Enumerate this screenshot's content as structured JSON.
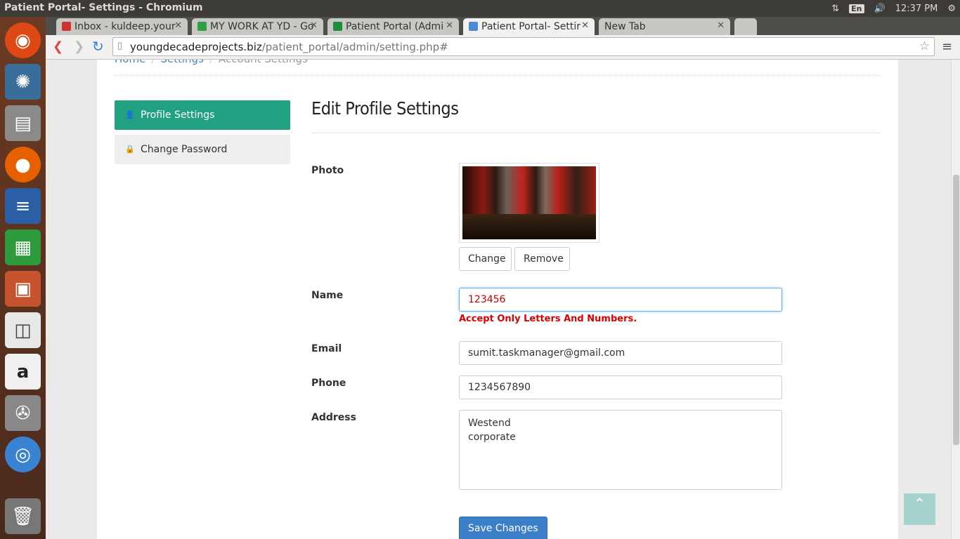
{
  "os": {
    "window_title": "Patient Portal- Settings - Chromium",
    "lang": "En",
    "clock": "12:37 PM"
  },
  "browser": {
    "tabs": [
      {
        "label": "Inbox - kuldeep.your",
        "color": "#c33"
      },
      {
        "label": "MY WORK AT YD - Go",
        "color": "#2f9e44"
      },
      {
        "label": "Patient Portal (Admi",
        "color": "#1e8e3e"
      },
      {
        "label": "Patient Portal- Settir",
        "color": "#4a8ad4"
      },
      {
        "label": "New Tab",
        "color": ""
      }
    ],
    "url_host": "youngdecadeprojects.biz",
    "url_path": "/patient_portal/admin/setting.php#"
  },
  "breadcrumb": {
    "home": "Home",
    "settings": "Settings",
    "current": "Account Settings"
  },
  "sidebar": {
    "profile": "Profile Settings",
    "password": "Change Password"
  },
  "page_title": "Edit Profile Settings",
  "form": {
    "photo_label": "Photo",
    "change_label": "Change",
    "remove_label": "Remove",
    "name_label": "Name",
    "name_value": "123456",
    "name_error": "Accept Only Letters And Numbers.",
    "email_label": "Email",
    "email_value": "sumit.taskmanager@gmail.com",
    "phone_label": "Phone",
    "phone_value": "1234567890",
    "address_label": "Address",
    "address_value": "Westend\ncorporate",
    "save_label": "Save Changes"
  }
}
